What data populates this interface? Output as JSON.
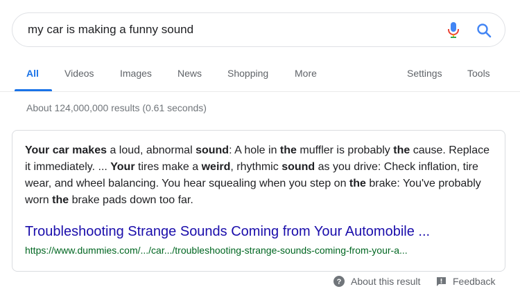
{
  "search": {
    "query": "my car is making a funny sound"
  },
  "tabs": [
    {
      "label": "All",
      "active": true
    },
    {
      "label": "Videos"
    },
    {
      "label": "Images"
    },
    {
      "label": "News"
    },
    {
      "label": "Shopping"
    },
    {
      "label": "More"
    }
  ],
  "tools": {
    "settings": "Settings",
    "tools": "Tools"
  },
  "stats": "About 124,000,000 results (0.61 seconds)",
  "snippet": {
    "parts": [
      {
        "t": "Your car makes",
        "b": true
      },
      {
        "t": " a loud, abnormal "
      },
      {
        "t": "sound",
        "b": true
      },
      {
        "t": ": A hole in "
      },
      {
        "t": "the",
        "b": true
      },
      {
        "t": " muffler is probably "
      },
      {
        "t": "the",
        "b": true
      },
      {
        "t": " cause. Replace it immediately. ... "
      },
      {
        "t": "Your",
        "b": true
      },
      {
        "t": " tires make a "
      },
      {
        "t": "weird",
        "b": true
      },
      {
        "t": ", rhythmic "
      },
      {
        "t": "sound",
        "b": true
      },
      {
        "t": " as you drive: Check inflation, tire wear, and wheel balancing. You hear squealing when you step on "
      },
      {
        "t": "the",
        "b": true
      },
      {
        "t": " brake: You've probably worn "
      },
      {
        "t": "the",
        "b": true
      },
      {
        "t": " brake pads down too far."
      }
    ],
    "title": "Troubleshooting Strange Sounds Coming from Your Automobile ...",
    "url": "https://www.dummies.com/.../car.../troubleshooting-strange-sounds-coming-from-your-a..."
  },
  "footer": {
    "about": "About this result",
    "feedback": "Feedback"
  },
  "colors": {
    "accent": "#1a73e8",
    "link": "#1a0dab",
    "url": "#006621",
    "muted": "#5f6368"
  },
  "icons": {
    "mic": "microphone-icon",
    "search": "magnifier-icon",
    "help": "help-circle-icon",
    "feedback": "feedback-icon"
  }
}
